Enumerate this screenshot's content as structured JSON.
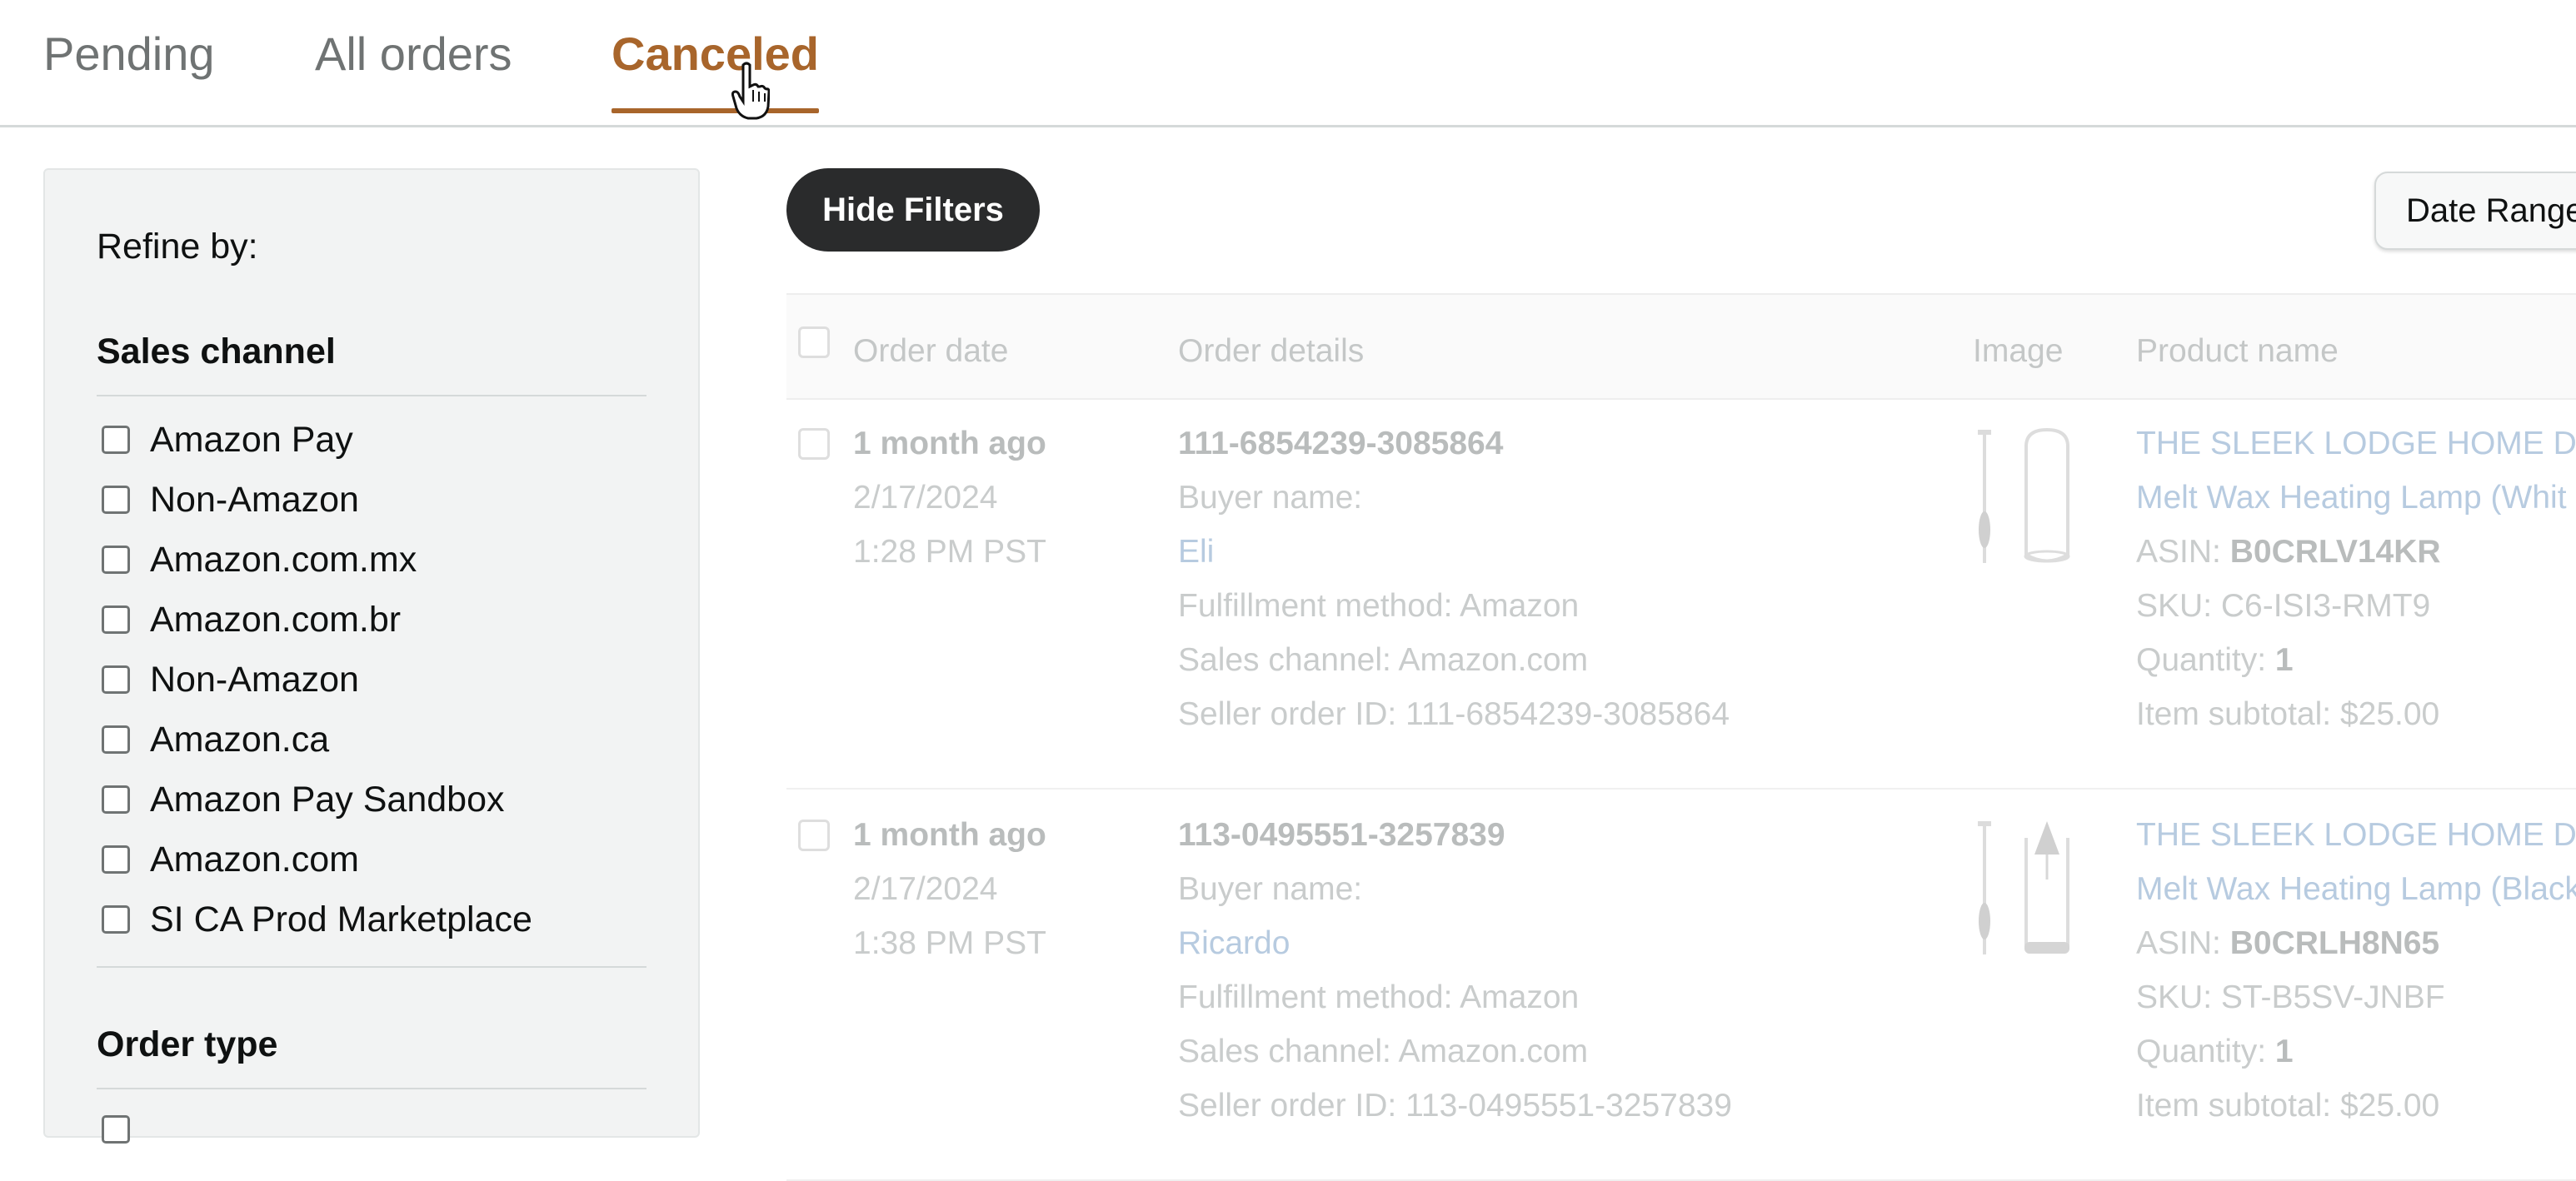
{
  "tabs": [
    {
      "label": "Pending"
    },
    {
      "label": "All orders"
    },
    {
      "label": "Canceled"
    }
  ],
  "sidebar": {
    "refine_label": "Refine by:",
    "sales_channel": {
      "title": "Sales channel",
      "options": [
        "Amazon Pay",
        "Non-Amazon",
        "Amazon.com.mx",
        "Amazon.com.br",
        "Non-Amazon",
        "Amazon.ca",
        "Amazon Pay Sandbox",
        "Amazon.com",
        "SI CA Prod Marketplace"
      ]
    },
    "order_type": {
      "title": "Order type"
    }
  },
  "toolbar": {
    "hide_filters_label": "Hide Filters",
    "date_range_label": "Date Range"
  },
  "table": {
    "headers": {
      "order_date": "Order date",
      "order_details": "Order details",
      "image": "Image",
      "product_name": "Product name"
    },
    "rows": [
      {
        "relative_date": "1 month ago",
        "date": "2/17/2024",
        "time": "1:28 PM PST",
        "order_id": "111-6854239-3085864",
        "buyer_label": "Buyer name:",
        "buyer_name": "Eli",
        "fulfillment": "Fulfillment method: Amazon",
        "sales_channel": "Sales channel: Amazon.com",
        "seller_order_id": "Seller order ID: 111-6854239-3085864",
        "product_title": "THE SLEEK LODGE HOME DEC",
        "product_subtitle": "Melt Wax Heating Lamp (Whit",
        "asin_label": "ASIN:",
        "asin": "B0CRLV14KR",
        "sku": "SKU: C6-ISI3-RMT9",
        "quantity_label": "Quantity:",
        "quantity": "1",
        "subtotal": "Item subtotal: $25.00"
      },
      {
        "relative_date": "1 month ago",
        "date": "2/17/2024",
        "time": "1:38 PM PST",
        "order_id": "113-0495551-3257839",
        "buyer_label": "Buyer name:",
        "buyer_name": "Ricardo",
        "fulfillment": "Fulfillment method: Amazon",
        "sales_channel": "Sales channel: Amazon.com",
        "seller_order_id": "Seller order ID: 113-0495551-3257839",
        "product_title": "THE SLEEK LODGE HOME DEC",
        "product_subtitle": "Melt Wax Heating Lamp (Black",
        "asin_label": "ASIN:",
        "asin": "B0CRLH8N65",
        "sku": "SKU: ST-B5SV-JNBF",
        "quantity_label": "Quantity:",
        "quantity": "1",
        "subtotal": "Item subtotal: $25.00"
      }
    ]
  },
  "colors": {
    "active_tab": "#a8652b",
    "button_dark": "#2a2b2c",
    "sidebar_bg": "#f2f3f3"
  }
}
